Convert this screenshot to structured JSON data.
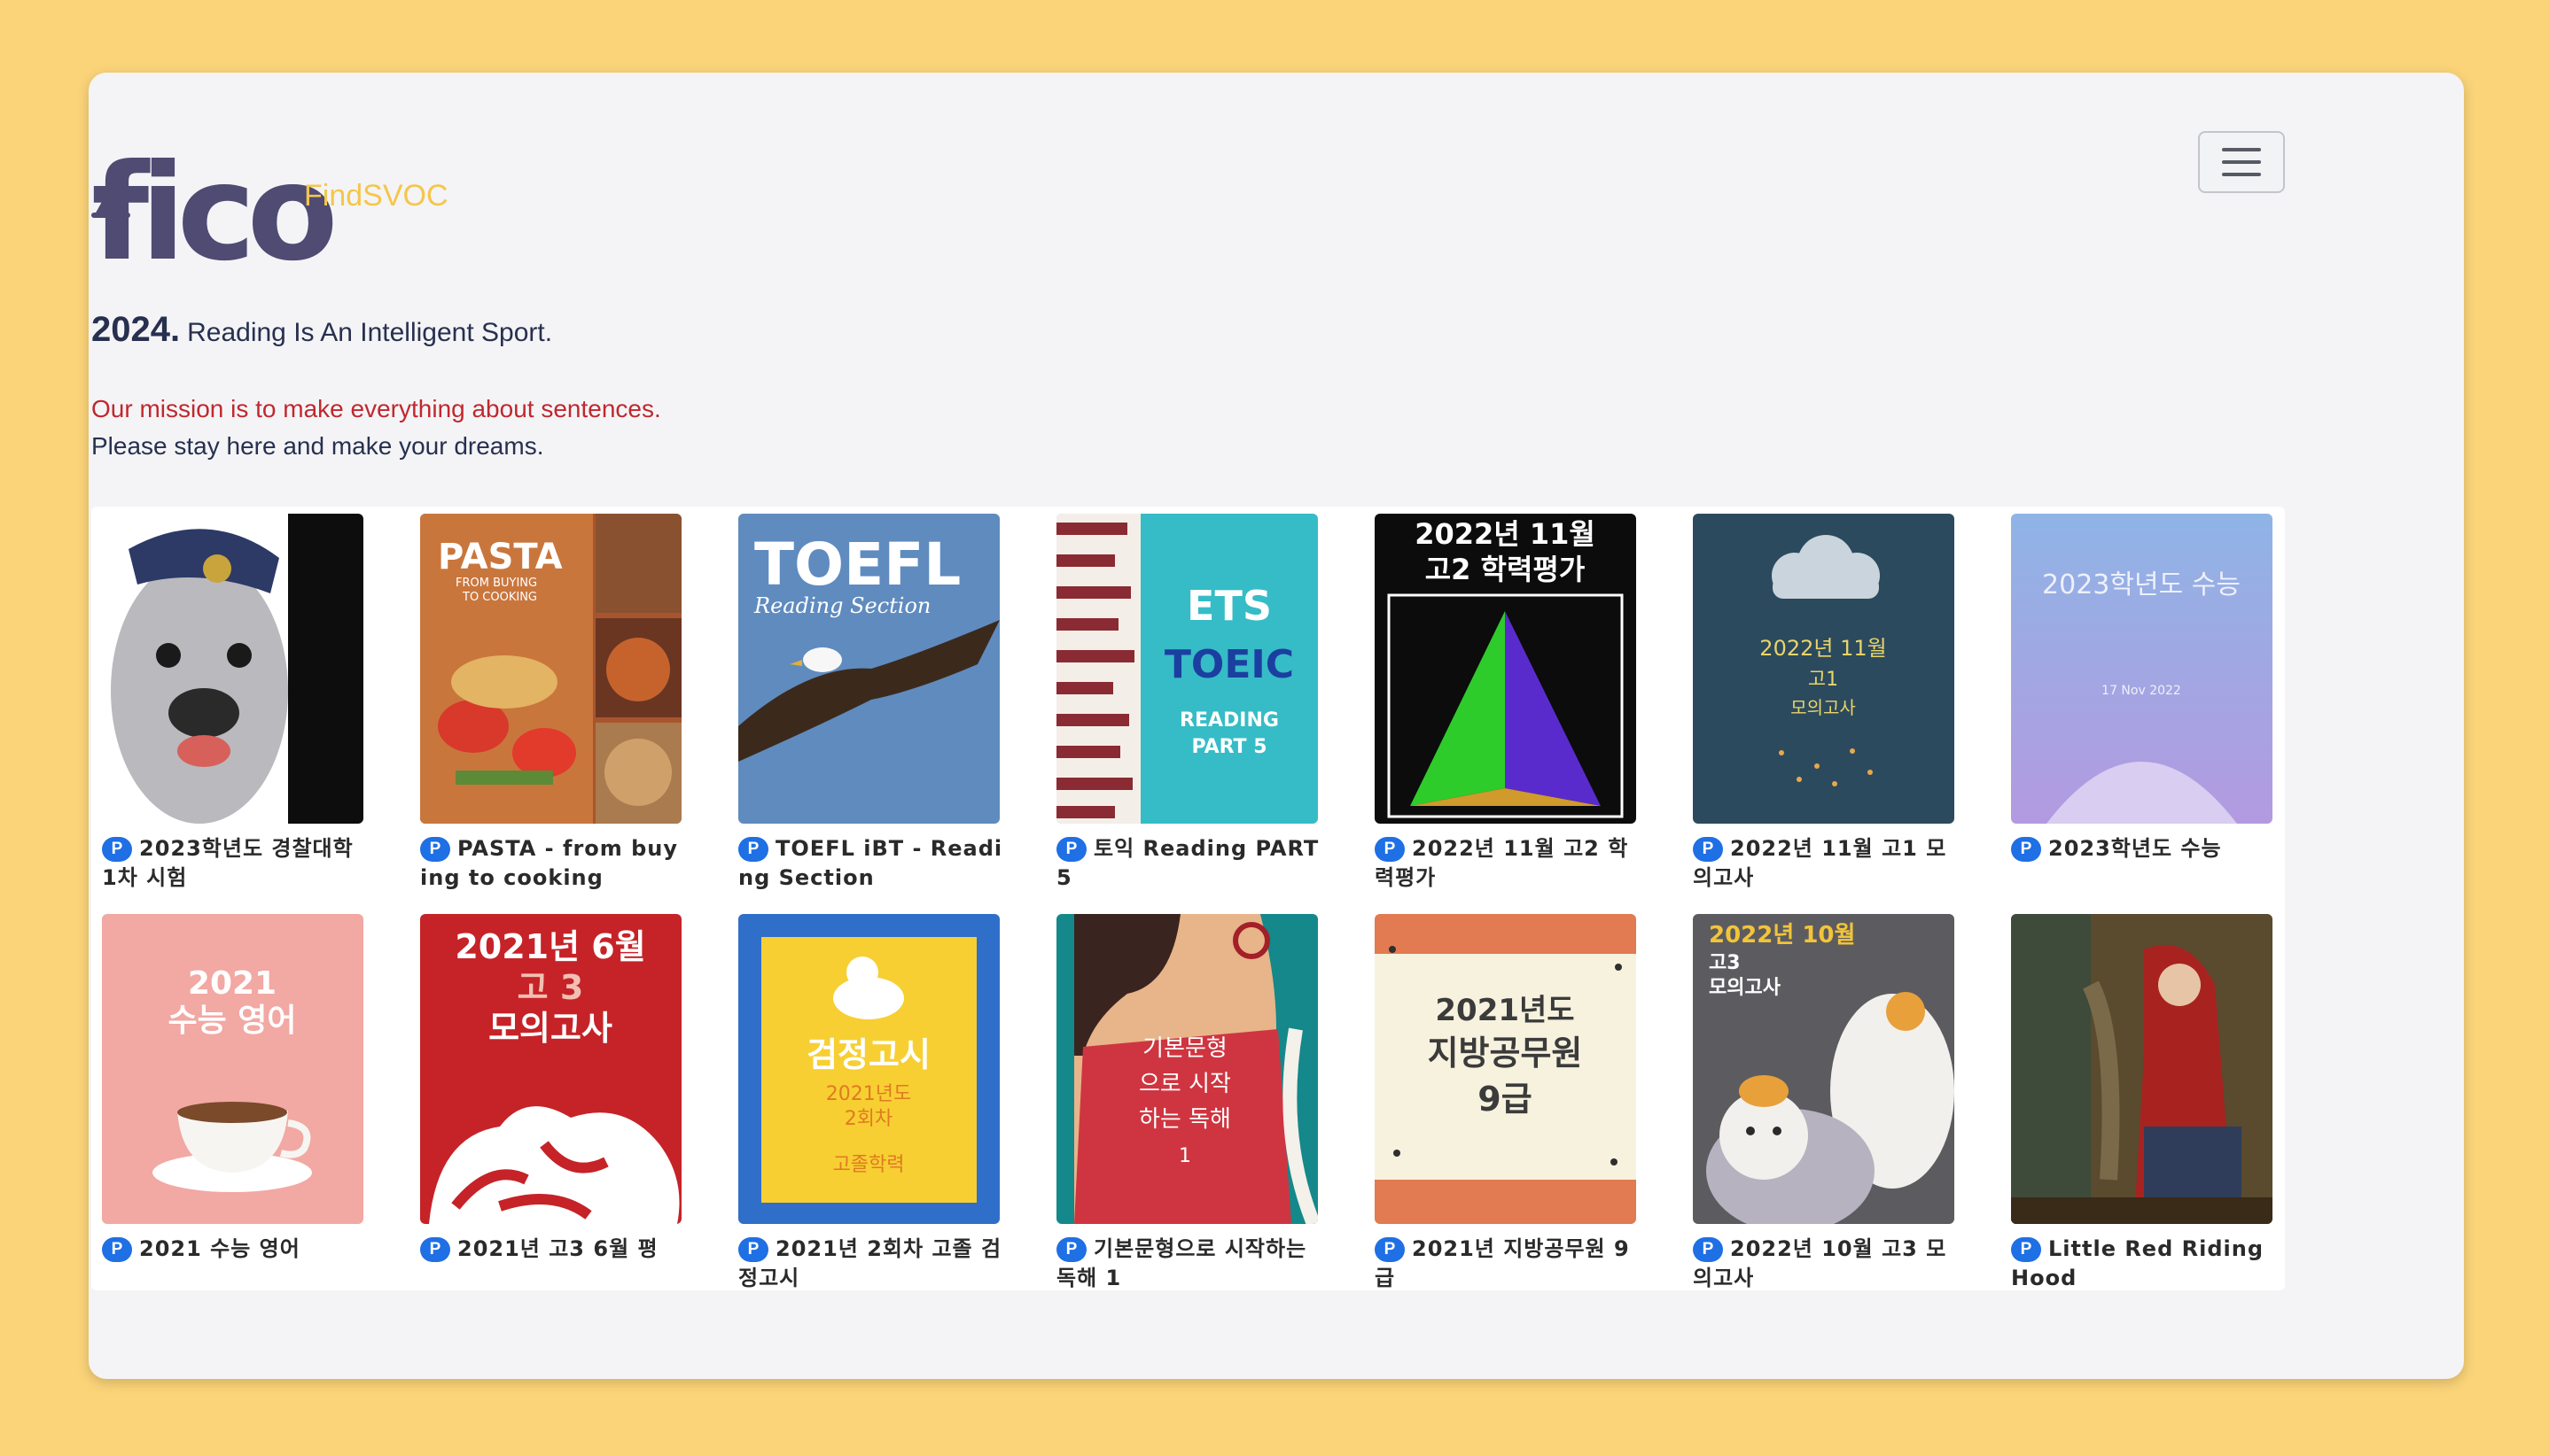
{
  "logo": {
    "word": "fico",
    "sub": "FindSVOC"
  },
  "tagline": {
    "year": "2024.",
    "text": "Reading Is An Intelligent Sport."
  },
  "mission": {
    "line1": "Our mission is to make everything about sentences.",
    "line2": "Please stay here and make your dreams."
  },
  "badge": "P",
  "books": [
    {
      "title": "2023학년도 경찰대학 1차 시험"
    },
    {
      "title": "PASTA - from buying to cooking",
      "cover_text": [
        "PASTA",
        "FROM BUYING",
        "TO COOKING"
      ]
    },
    {
      "title": "TOEFL iBT - Reading Section",
      "cover_text": [
        "TOEFL",
        "Reading Section"
      ]
    },
    {
      "title": "토익 Reading PART 5",
      "cover_text": [
        "ETS",
        "TOEIC",
        "READING",
        "PART 5"
      ]
    },
    {
      "title": "2022년 11월 고2 학력평가",
      "cover_text": [
        "2022년 11월",
        "고2 학력평가"
      ]
    },
    {
      "title": "2022년 11월 고1 모의고사",
      "cover_text": [
        "2022년 11월",
        "고1",
        "모의고사"
      ]
    },
    {
      "title": "2023학년도 수능",
      "cover_text": [
        "2023학년도 수능",
        "17 Nov 2022"
      ]
    },
    {
      "title": "2021 수능 영어",
      "cover_text": [
        "2021",
        "수능 영어"
      ]
    },
    {
      "title": "2021년 고3 6월 평",
      "cover_text": [
        "2021년 6월",
        "고 3",
        "모의고사"
      ]
    },
    {
      "title": "2021년 2회차 고졸 검정고시",
      "cover_text": [
        "검정고시",
        "2021년도",
        "2회차",
        "고졸학력"
      ]
    },
    {
      "title": "기본문형으로 시작하는 독해 1",
      "cover_text": [
        "기본문형",
        "으로 시작",
        "하는 독해",
        "1"
      ]
    },
    {
      "title": "2021년 지방공무원 9급",
      "cover_text": [
        "2021년도",
        "지방공무원",
        "9급"
      ]
    },
    {
      "title": "2022년 10월 고3 모의고사",
      "cover_text": [
        "2022년 10월",
        "고3",
        "모의고사"
      ]
    },
    {
      "title": "Little Red Riding Hood"
    }
  ]
}
